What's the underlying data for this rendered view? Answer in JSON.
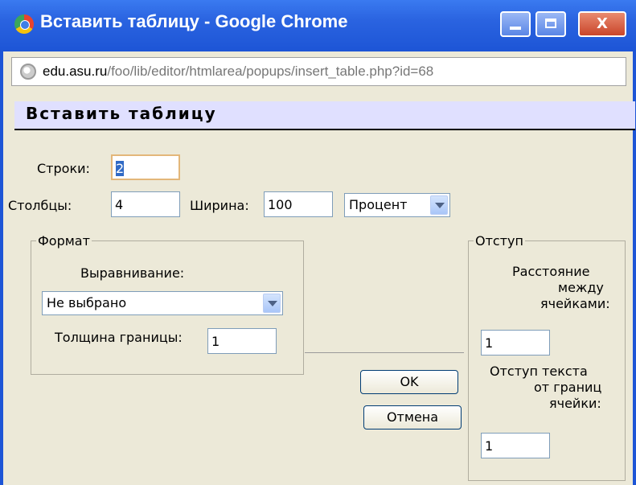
{
  "window": {
    "title": "Вставить таблицу - Google Chrome",
    "controls": {
      "minimize": "",
      "maximize": "",
      "close": "X"
    }
  },
  "address": {
    "domain": "edu.asu.ru",
    "path": "/foo/lib/editor/htmlarea/popups/insert_table.php?id=68"
  },
  "dialog": {
    "title": "Вставить таблицу",
    "rows": {
      "label": "Строки:",
      "value": "2"
    },
    "cols": {
      "label": "Столбцы:",
      "value": "4"
    },
    "width": {
      "label": "Ширина:",
      "value": "100",
      "unit": "Процент"
    },
    "format": {
      "legend": "Формат",
      "align_label": "Выравнивание:",
      "align_value": "Не выбрано",
      "border_label": "Толщина границы:",
      "border_value": "1"
    },
    "spacing": {
      "legend": "Отступ",
      "cell_spacing_label": [
        "Расстояние",
        "между",
        "ячейками:"
      ],
      "cell_spacing_value": "1",
      "cell_padding_label": [
        "Отступ текста",
        "от границ",
        "ячейки:"
      ],
      "cell_padding_value": "1"
    },
    "ok_label": "OK",
    "cancel_label": "Отмена"
  },
  "colors": {
    "titlebar": "#2a63e0",
    "dialog_bg": "#ece9d8",
    "header_bg": "#e0e0ff"
  }
}
